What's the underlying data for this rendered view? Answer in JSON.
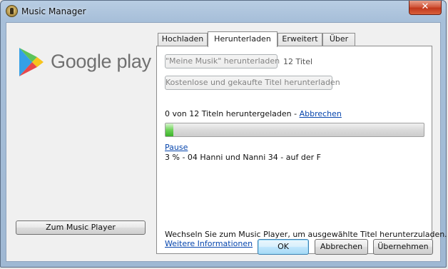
{
  "window": {
    "title": "Music Manager",
    "close_label": "✕"
  },
  "logo": {
    "text": "Google play"
  },
  "sidebar": {
    "music_player_button": "Zum Music Player"
  },
  "tabs": [
    {
      "label": "Hochladen",
      "active": false
    },
    {
      "label": "Herunterladen",
      "active": true
    },
    {
      "label": "Erweitert",
      "active": false
    },
    {
      "label": "Über",
      "active": false
    }
  ],
  "download": {
    "my_music_button": "\"Meine Musik\" herunterladen",
    "my_music_count": "12 Titel",
    "free_purchased_button": "Kostenlose und gekaufte Titel herunterladen",
    "status_text": "0 von 12 Titeln heruntergeladen - ",
    "cancel_link": "Abbrechen",
    "progress_percent": 3,
    "pause_link": "Pause",
    "current_track": "3 % - 04 Hanni und Nanni 34 - auf der F",
    "info_text": "Wechseln Sie zum Music Player, um ausgewählte Titel herunterzuladen.",
    "more_info_link": "Weitere Informationen"
  },
  "footer": {
    "ok": "OK",
    "cancel": "Abbrechen",
    "apply": "Übernehmen"
  }
}
